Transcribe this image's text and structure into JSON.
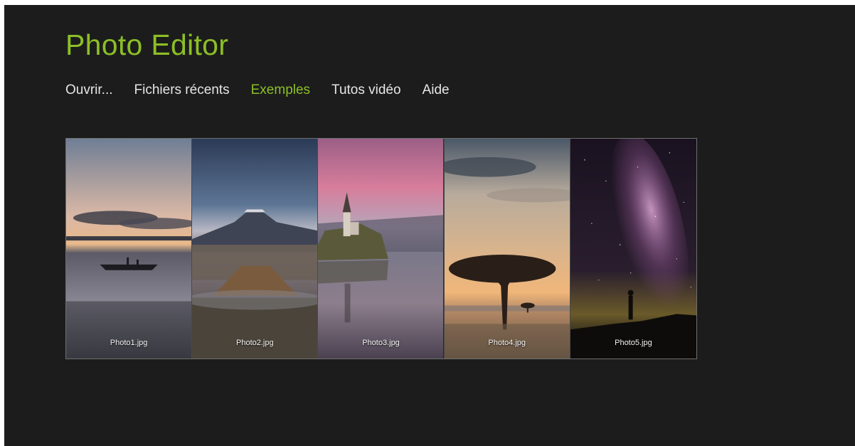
{
  "app": {
    "title": "Photo Editor",
    "accent_color": "#8cbf26",
    "text_color": "#e6e6e6"
  },
  "nav": {
    "items": [
      {
        "label": "Ouvrir...",
        "active": false
      },
      {
        "label": "Fichiers récents",
        "active": false
      },
      {
        "label": "Exemples",
        "active": true
      },
      {
        "label": "Tutos vidéo",
        "active": false
      },
      {
        "label": "Aide",
        "active": false
      }
    ]
  },
  "gallery": {
    "photos": [
      {
        "filename": "Photo1.jpg",
        "subject": "lake sunset with boat"
      },
      {
        "filename": "Photo2.jpg",
        "subject": "volcano landscape"
      },
      {
        "filename": "Photo3.jpg",
        "subject": "island church on lake"
      },
      {
        "filename": "Photo4.jpg",
        "subject": "acacia tree at sunset"
      },
      {
        "filename": "Photo5.jpg",
        "subject": "milky way night sky"
      }
    ]
  }
}
